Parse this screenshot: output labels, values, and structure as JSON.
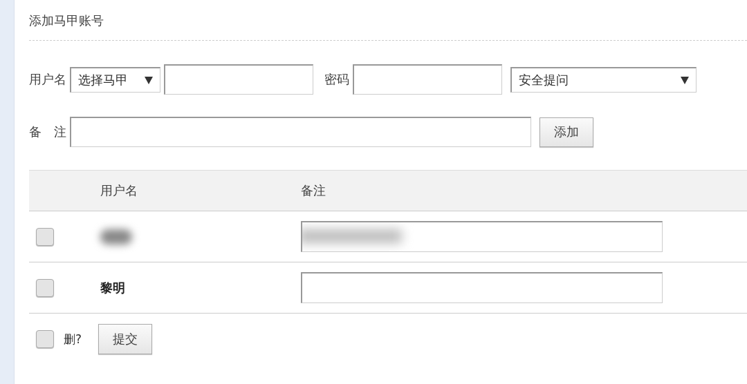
{
  "section_title": "添加马甲账号",
  "add_form": {
    "username_label": "用户名",
    "username_select": "选择马甲",
    "password_label": "密码",
    "question_select": "安全提问",
    "note_label": "备　注",
    "add_button": "添加"
  },
  "table": {
    "columns": [
      "用户名",
      "备注"
    ],
    "rows": [
      {
        "checked": false,
        "redacted": true
      },
      {
        "checked": false,
        "redacted": false,
        "username": "黎明"
      }
    ]
  },
  "footer": {
    "checked": false,
    "delete_label": "删?",
    "submit_button": "提交"
  }
}
